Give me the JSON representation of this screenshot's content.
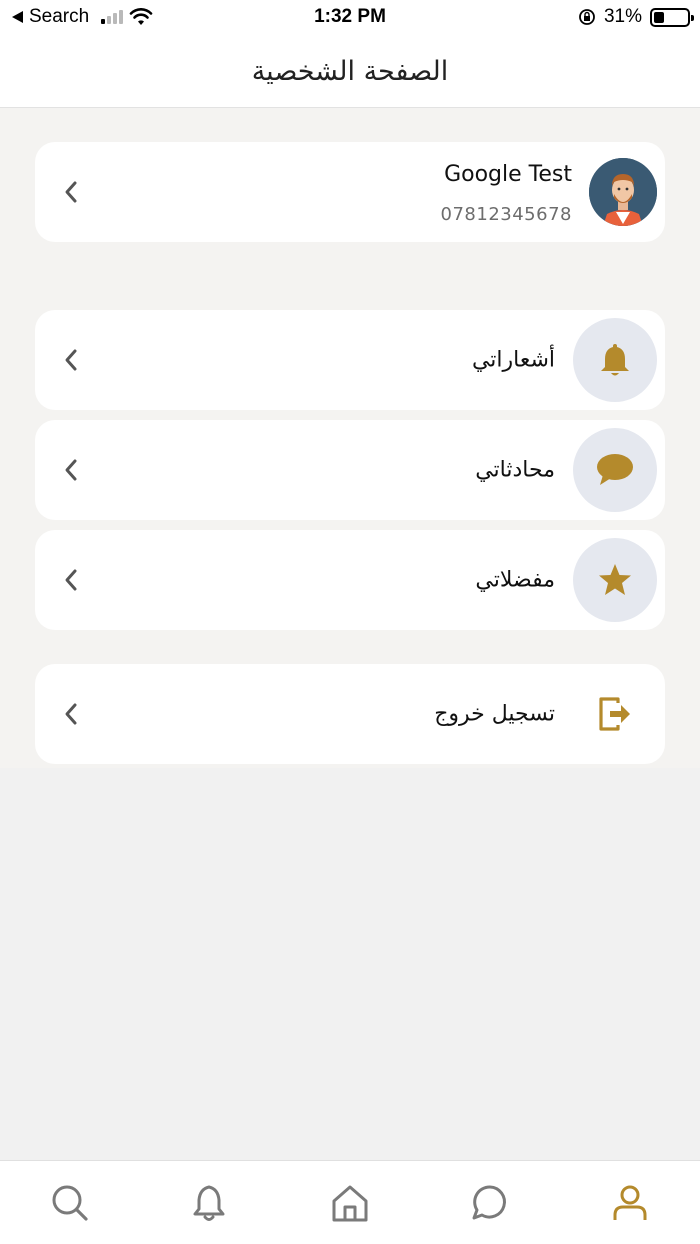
{
  "status_bar": {
    "back_label": "Search",
    "time": "1:32 PM",
    "battery": "31%"
  },
  "header": {
    "title": "الصفحة الشخصية"
  },
  "profile": {
    "name": "Google Test",
    "phone": "07812345678"
  },
  "menu": [
    {
      "label": "أشعاراتي",
      "icon": "bell-icon"
    },
    {
      "label": "محادثاتي",
      "icon": "chat-bubble-icon"
    },
    {
      "label": "مفضلاتي",
      "icon": "star-icon"
    }
  ],
  "logout": {
    "label": "تسجيل خروج",
    "icon": "logout-icon"
  },
  "bottom_nav": {
    "items": [
      "search-icon",
      "bell-icon",
      "home-icon",
      "chat-icon",
      "user-icon"
    ],
    "active": "user-icon"
  },
  "colors": {
    "accent": "#b48a2c",
    "icon_circle_bg": "#e5e8ef",
    "nav_inactive": "#7a7a7a"
  }
}
